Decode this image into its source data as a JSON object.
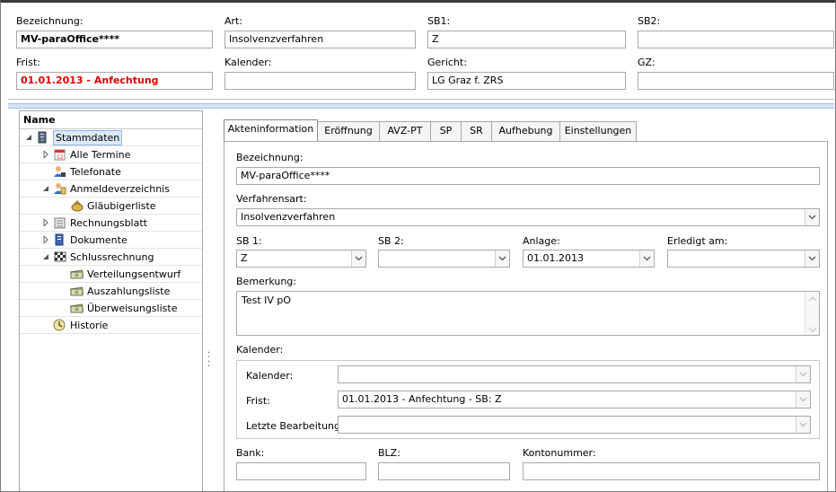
{
  "header": {
    "bezeichnung_label": "Bezeichnung:",
    "bezeichnung_value": "MV-paraOffice****",
    "art_label": "Art:",
    "art_value": "Insolvenzverfahren",
    "sb1_label": "SB1:",
    "sb1_value": "Z",
    "sb2_label": "SB2:",
    "sb2_value": "",
    "frist_label": "Frist:",
    "frist_value": "01.01.2013 - Anfechtung",
    "kalender_label": "Kalender:",
    "kalender_value": "",
    "gericht_label": "Gericht:",
    "gericht_value": "LG Graz f. ZRS",
    "gz_label": "GZ:",
    "gz_value": ""
  },
  "tree": {
    "header": "Name",
    "items": [
      {
        "label": "Stammdaten",
        "icon": "server-icon",
        "level": 0,
        "expander": "expanded",
        "selected": true
      },
      {
        "label": "Alle Termine",
        "icon": "calendar-icon",
        "level": 1,
        "expander": "collapsed"
      },
      {
        "label": "Telefonate",
        "icon": "phone-user-icon",
        "level": 1,
        "expander": "none"
      },
      {
        "label": "Anmeldeverzeichnis",
        "icon": "user-register-icon",
        "level": 1,
        "expander": "expanded"
      },
      {
        "label": "Gläubigerliste",
        "icon": "money-bag-icon",
        "level": 2,
        "expander": "none"
      },
      {
        "label": "Rechnungsblatt",
        "icon": "ledger-icon",
        "level": 1,
        "expander": "collapsed"
      },
      {
        "label": "Dokumente",
        "icon": "documents-icon",
        "level": 1,
        "expander": "collapsed"
      },
      {
        "label": "Schlussrechnung",
        "icon": "checkered-flag-icon",
        "level": 1,
        "expander": "expanded"
      },
      {
        "label": "Verteilungsentwurf",
        "icon": "banknotes-icon",
        "level": 2,
        "expander": "none"
      },
      {
        "label": "Auszahlungsliste",
        "icon": "banknotes-icon",
        "level": 2,
        "expander": "none"
      },
      {
        "label": "Überweisungsliste",
        "icon": "banknotes-icon",
        "level": 2,
        "expander": "none"
      },
      {
        "label": "Historie",
        "icon": "history-icon",
        "level": 1,
        "expander": "none"
      }
    ]
  },
  "tabs": [
    {
      "label": "Akteninformation",
      "active": true
    },
    {
      "label": "Eröffnung"
    },
    {
      "label": "AVZ-PT"
    },
    {
      "label": "SP"
    },
    {
      "label": "SR"
    },
    {
      "label": "Aufhebung"
    },
    {
      "label": "Einstellungen"
    }
  ],
  "form": {
    "bezeichnung_label": "Bezeichnung:",
    "bezeichnung_value": "MV-paraOffice****",
    "verfahrensart_label": "Verfahrensart:",
    "verfahrensart_value": "Insolvenzverfahren",
    "sb1_label": "SB 1:",
    "sb1_value": "Z",
    "sb2_label": "SB 2:",
    "sb2_value": "",
    "anlage_label": "Anlage:",
    "anlage_value": "01.01.2013",
    "erledigt_label": "Erledigt am:",
    "erledigt_value": "",
    "bemerkung_label": "Bemerkung:",
    "bemerkung_value": "Test IV pO",
    "kalender_group_label": "Kalender:",
    "kal_kalender_label": "Kalender:",
    "kal_kalender_value": "",
    "kal_frist_label": "Frist:",
    "kal_frist_value": "01.01.2013 - Anfechtung - SB: Z",
    "kal_letzte_label": "Letzte Bearbeitung:",
    "kal_letzte_value": "",
    "bank_label": "Bank:",
    "bank_value": "",
    "blz_label": "BLZ:",
    "blz_value": "",
    "konto_label": "Kontonummer:",
    "konto_value": ""
  },
  "colors": {
    "frist_red": "#e00000",
    "selection_blue": "#dce9f8",
    "splitter_blue": "#d4e3f5"
  }
}
